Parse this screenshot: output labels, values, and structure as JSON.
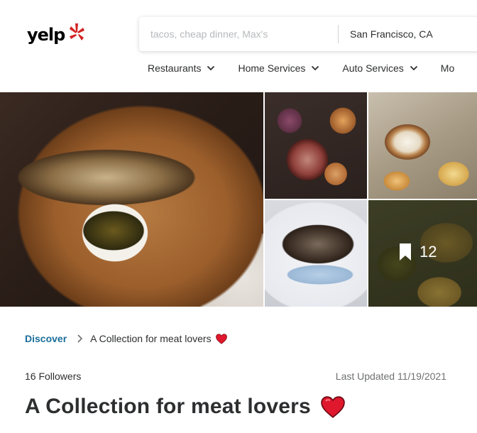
{
  "header": {
    "logo_text": "yelp",
    "search": {
      "find_placeholder": "tacos, cheap dinner, Max's",
      "location_value": "San Francisco, CA"
    },
    "nav": [
      {
        "label": "Restaurants"
      },
      {
        "label": "Home Services"
      },
      {
        "label": "Auto Services"
      },
      {
        "label": "Mo"
      }
    ]
  },
  "photos": {
    "saved_count": "12"
  },
  "breadcrumb": {
    "root": "Discover",
    "current": "A Collection for meat lovers"
  },
  "collection": {
    "followers": "16 Followers",
    "last_updated": "Last Updated 11/19/2021",
    "title": "A Collection for meat lovers"
  },
  "colors": {
    "yelp_red": "#d32323",
    "link_blue": "#1a6e9a",
    "heart": "#e0182d"
  }
}
